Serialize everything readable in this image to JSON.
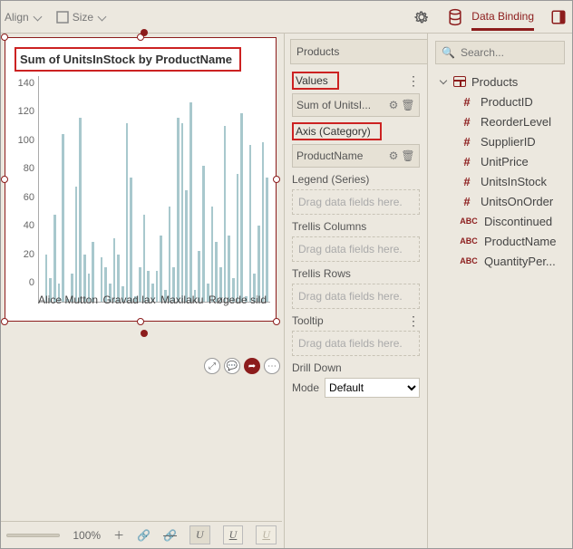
{
  "toolbar": {
    "align_label": "Align",
    "size_label": "Size"
  },
  "header": {
    "tab_label": "Data Binding"
  },
  "datasource": {
    "name": "Products"
  },
  "chart": {
    "title": "Sum of UnitsInStock by ProductName",
    "x_labels": [
      "Alice Mutton",
      "Gravad lax",
      "Maxilaku",
      "Røgede sild"
    ]
  },
  "chart_data": {
    "type": "bar",
    "title": "Sum of UnitsInStock by ProductName",
    "xlabel": "ProductName",
    "ylabel": "Sum of UnitsInStock",
    "ylim": [
      0,
      140
    ],
    "y_ticks": [
      0,
      20,
      40,
      60,
      80,
      100,
      120,
      140
    ],
    "categories_shown": [
      "Alice Mutton",
      "Gravad lax",
      "Maxilaku",
      "Røgede sild"
    ],
    "values": [
      0,
      30,
      15,
      55,
      12,
      105,
      2,
      18,
      72,
      115,
      30,
      18,
      38,
      0,
      28,
      22,
      12,
      40,
      30,
      10,
      112,
      78,
      4,
      22,
      55,
      20,
      12,
      20,
      42,
      8,
      60,
      22,
      115,
      112,
      70,
      125,
      8,
      32,
      85,
      12,
      60,
      38,
      22,
      110,
      42,
      15,
      80,
      118,
      4,
      98,
      18,
      48,
      100,
      78
    ]
  },
  "config": {
    "values": {
      "title": "Values",
      "chip": "Sum of UnitsI..."
    },
    "axis": {
      "title": "Axis (Category)",
      "chip": "ProductName"
    },
    "legend": {
      "title": "Legend (Series)",
      "placeholder": "Drag data fields here."
    },
    "tcols": {
      "title": "Trellis Columns",
      "placeholder": "Drag data fields here."
    },
    "trows": {
      "title": "Trellis Rows",
      "placeholder": "Drag data fields here."
    },
    "tooltip": {
      "title": "Tooltip",
      "placeholder": "Drag data fields here."
    },
    "drill": {
      "title": "Drill Down",
      "mode_label": "Mode",
      "mode_value": "Default"
    }
  },
  "fields": {
    "search_placeholder": "Search...",
    "table": "Products",
    "items": [
      {
        "type": "num",
        "label": "ProductID"
      },
      {
        "type": "num",
        "label": "ReorderLevel"
      },
      {
        "type": "num",
        "label": "SupplierID"
      },
      {
        "type": "num",
        "label": "UnitPrice"
      },
      {
        "type": "num",
        "label": "UnitsInStock"
      },
      {
        "type": "num",
        "label": "UnitsOnOrder"
      },
      {
        "type": "abc",
        "label": "Discontinued"
      },
      {
        "type": "abc",
        "label": "ProductName"
      },
      {
        "type": "abc",
        "label": "QuantityPer..."
      }
    ]
  },
  "footer": {
    "zoom": "100%"
  }
}
